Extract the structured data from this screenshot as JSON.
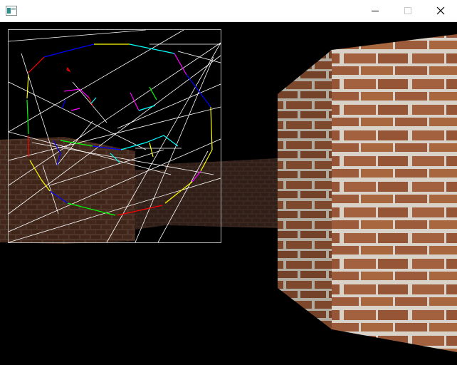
{
  "window": {
    "title": "",
    "controls": {
      "minimize_icon": "minimize-icon",
      "maximize_icon": "maximize-icon",
      "close_icon": "close-icon"
    }
  },
  "scene": {
    "description_type": "first-person raycast maze",
    "background_color": "#000000",
    "brick_color": "#9a5a3a",
    "mortar_color": "#d8d2c8",
    "minimap": {
      "border_color": "#b8b8b8",
      "ray_color": "#ffffff",
      "wall_colors": [
        "#ffff00",
        "#00ffff",
        "#0000ff",
        "#ff00ff",
        "#00ff00",
        "#ff0000"
      ]
    }
  }
}
